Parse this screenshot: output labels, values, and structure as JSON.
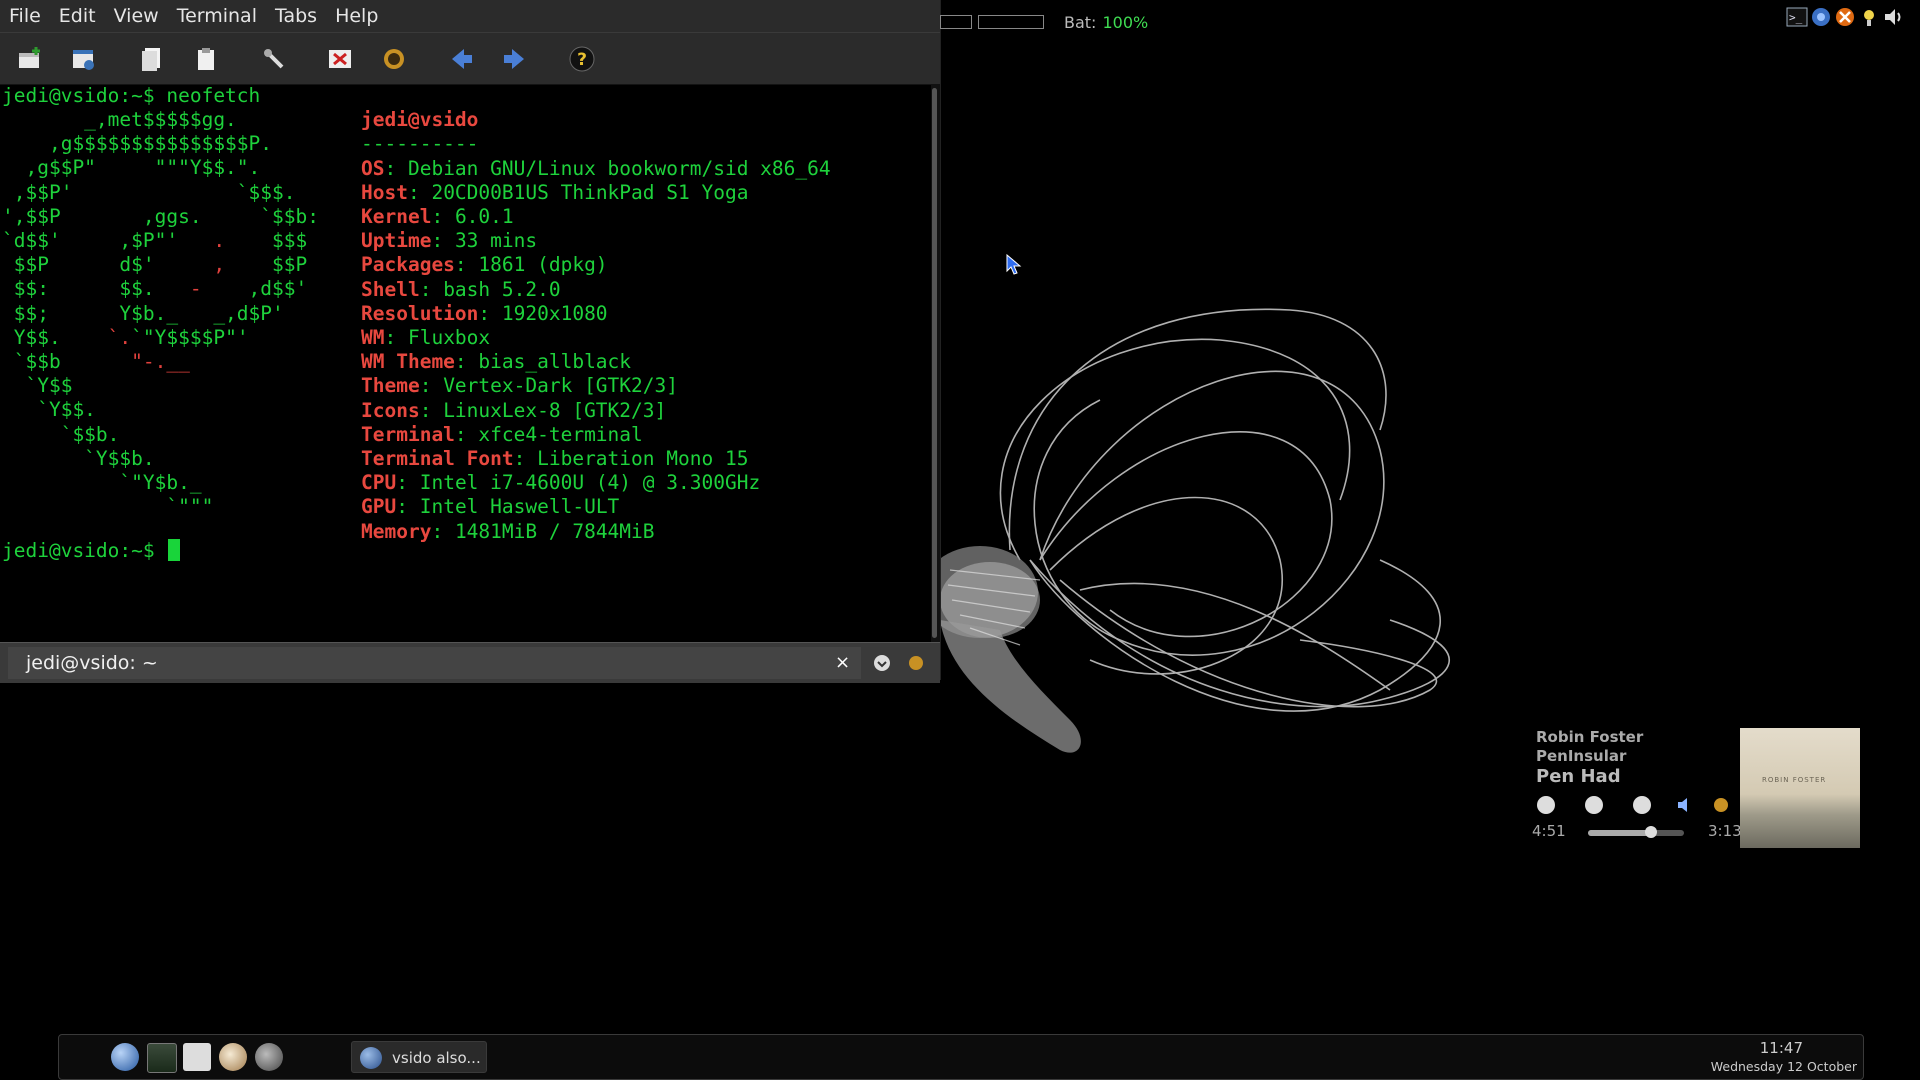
{
  "terminal": {
    "menu": [
      "File",
      "Edit",
      "View",
      "Terminal",
      "Tabs",
      "Help"
    ],
    "toolbar_icons": [
      "new-tab-icon",
      "new-window-icon",
      "copy-icon",
      "paste-icon",
      "settings-icon",
      "fullscreen-icon",
      "appearance-icon",
      "back-arrow-icon",
      "forward-arrow-icon",
      "help-icon"
    ],
    "prompt_command": "jedi@vsido:~$ neofetch",
    "ascii_logo": [
      {
        "green": "       _,met$$$$$gg.",
        "red": ""
      },
      {
        "green": "    ,g$$$$$$$$$$$$$$$P.",
        "red": ""
      },
      {
        "green": "  ,g$$P\"     \"\"\"Y$$.\".",
        "red": ""
      },
      {
        "green": " ,$$P'              `$$$.",
        "red": ""
      },
      {
        "green": "',$$P       ,ggs.     `$$b:",
        "red": ""
      },
      {
        "green": "`d$$'     ,$P\"'   ",
        "red": ".",
        "green2": "    $$$"
      },
      {
        "green": " $$P      d$'     ",
        "red": ",",
        "green2": "    $$P"
      },
      {
        "green": " $$:      $$.   ",
        "red": "-",
        "green2": "    ,d$$'"
      },
      {
        "green": " $$;      Y$b._   _,d$P'",
        "red": ""
      },
      {
        "green": " Y$$.    ",
        "red": "`.",
        "green2": "`\"Y$$$$P\"'"
      },
      {
        "green": " `$$b      ",
        "red": "\"-.__",
        "green2": ""
      },
      {
        "green": "  `Y$$",
        "red": ""
      },
      {
        "green": "   `Y$$.",
        "red": ""
      },
      {
        "green": "     `$$b.",
        "red": ""
      },
      {
        "green": "       `Y$$b.",
        "red": ""
      },
      {
        "green": "          `\"Y$b._",
        "red": ""
      },
      {
        "green": "              `\"\"\"",
        "red": ""
      }
    ],
    "user_host": "jedi@vsido",
    "separator": "----------",
    "info": [
      {
        "key": "OS",
        "value": "Debian GNU/Linux bookworm/sid x86_64"
      },
      {
        "key": "Host",
        "value": "20CD00B1US ThinkPad S1 Yoga"
      },
      {
        "key": "Kernel",
        "value": "6.0.1"
      },
      {
        "key": "Uptime",
        "value": "33 mins"
      },
      {
        "key": "Packages",
        "value": "1861 (dpkg)"
      },
      {
        "key": "Shell",
        "value": "bash 5.2.0"
      },
      {
        "key": "Resolution",
        "value": "1920x1080"
      },
      {
        "key": "WM",
        "value": "Fluxbox"
      },
      {
        "key": "WM Theme",
        "value": "bias_allblack"
      },
      {
        "key": "Theme",
        "value": "Vertex-Dark [GTK2/3]"
      },
      {
        "key": "Icons",
        "value": "LinuxLex-8 [GTK2/3]"
      },
      {
        "key": "Terminal",
        "value": "xfce4-terminal"
      },
      {
        "key": "Terminal Font",
        "value": "Liberation Mono 15"
      },
      {
        "key": "CPU",
        "value": "Intel i7-4600U (4) @ 3.300GHz"
      },
      {
        "key": "GPU",
        "value": "Intel Haswell-ULT"
      },
      {
        "key": "Memory",
        "value": "1481MiB / 7844MiB"
      }
    ],
    "final_prompt": "jedi@vsido:~$ ",
    "tab_title": "jedi@vsido: ~",
    "tab_close": "×"
  },
  "status": {
    "bat_label": "Bat:",
    "bat_value": "100%"
  },
  "music": {
    "artist": "Robin Foster",
    "album": "PenInsular",
    "song": "Pen Had",
    "elapsed": "4:51",
    "total": "3:13",
    "progress": 0.66,
    "album_art_text": "ROBIN FOSTER"
  },
  "panel": {
    "launchers": [
      "browser-icon",
      "system-monitor-icon",
      "terminal-icon",
      "file-manager-icon",
      "vsido-icon"
    ],
    "task_label": "vsido also...",
    "clock_time": "11:47",
    "clock_date": "Wednesday 12 October"
  }
}
